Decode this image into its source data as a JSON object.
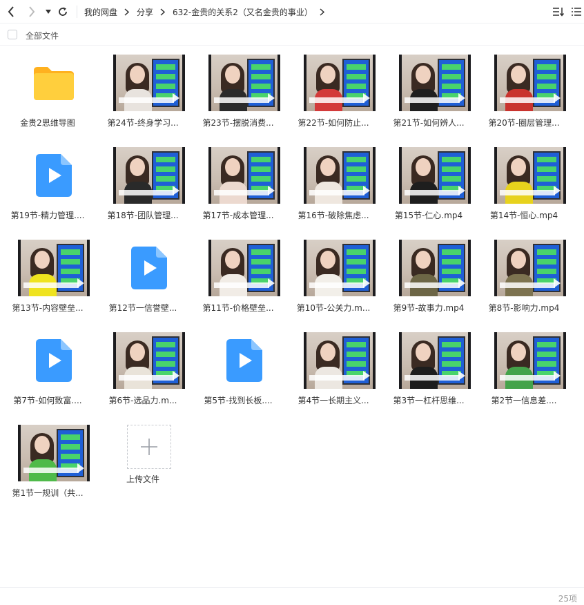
{
  "breadcrumbs": [
    "我的网盘",
    "分享",
    "632-金贵的关系2（又名金贵的事业）"
  ],
  "select_all_label": "全部文件",
  "files": [
    {
      "name": "金贵2思维导图",
      "kind": "folder"
    },
    {
      "name": "第24节-终身学习...",
      "kind": "video",
      "shirt": "#e8e3de"
    },
    {
      "name": "第23节-摆脱消费...",
      "kind": "video",
      "shirt": "#2b2b2b"
    },
    {
      "name": "第22节-如何防止...",
      "kind": "video",
      "shirt": "#d33a3a"
    },
    {
      "name": "第21节-如何辨人...",
      "kind": "video",
      "shirt": "#1f1f1f"
    },
    {
      "name": "第20节-圈层管理...",
      "kind": "video",
      "shirt": "#c9332e"
    },
    {
      "name": "第19节-精力管理....",
      "kind": "file"
    },
    {
      "name": "第18节-团队管理...",
      "kind": "video",
      "shirt": "#2a2a2a"
    },
    {
      "name": "第17节-成本管理...",
      "kind": "video",
      "shirt": "#ecd9cf"
    },
    {
      "name": "第16节-破除焦虑...",
      "kind": "video",
      "shirt": "#efe7df"
    },
    {
      "name": "第15节-仁心.mp4",
      "kind": "video",
      "shirt": "#1e1e1e"
    },
    {
      "name": "第14节-恒心.mp4",
      "kind": "video",
      "shirt": "#e7d21d"
    },
    {
      "name": "第13节-内容壁垒...",
      "kind": "video",
      "shirt": "#efe31f"
    },
    {
      "name": "第12节一信誉壁...",
      "kind": "file"
    },
    {
      "name": "第11节-价格壁垒...",
      "kind": "video",
      "shirt": "#f1ece6"
    },
    {
      "name": "第10节-公关力.m...",
      "kind": "video",
      "shirt": "#f2efe9"
    },
    {
      "name": "第9节-故事力.mp4",
      "kind": "video",
      "shirt": "#6d6646"
    },
    {
      "name": "第8节-影响力.mp4",
      "kind": "video",
      "shirt": "#7d7350"
    },
    {
      "name": "第7节-如何致富....",
      "kind": "file"
    },
    {
      "name": "第6节-选品力.m...",
      "kind": "video",
      "shirt": "#e9e3d9"
    },
    {
      "name": "第5节-找到长板....",
      "kind": "file"
    },
    {
      "name": "第4节一长期主义...",
      "kind": "video",
      "shirt": "#ece7e1"
    },
    {
      "name": "第3节一杠杆思维...",
      "kind": "video",
      "shirt": "#1d1d1d"
    },
    {
      "name": "第2节一信息差....",
      "kind": "video",
      "shirt": "#44a34a"
    },
    {
      "name": "第1节一规训（共...",
      "kind": "video",
      "shirt": "#4fba4a"
    }
  ],
  "upload_label": "上传文件",
  "item_count": "25项",
  "colors": {
    "accent_blue": "#3a8bff",
    "folder_yellow": "#ffc531"
  }
}
